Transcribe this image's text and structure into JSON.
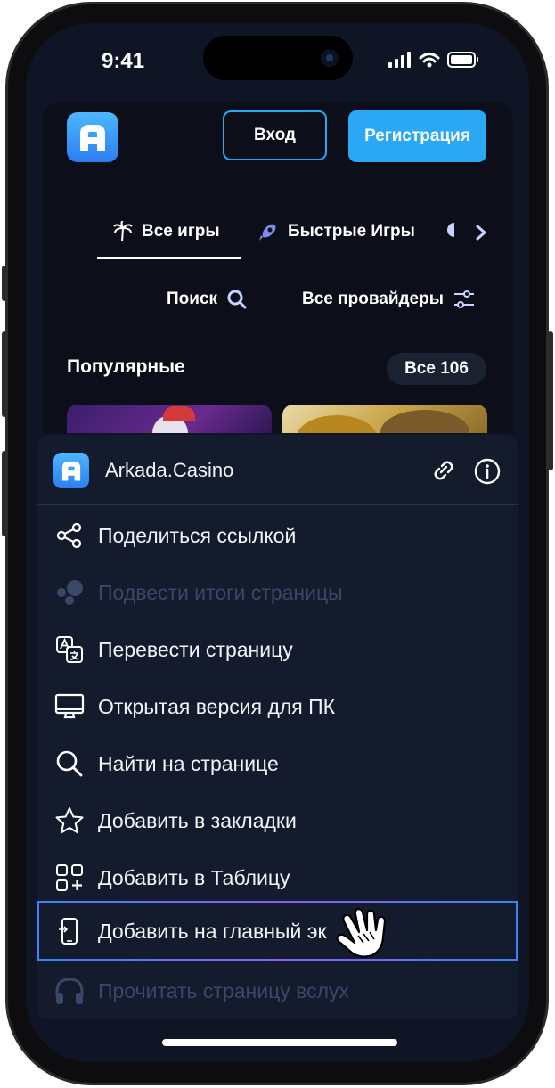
{
  "status_bar": {
    "time": "9:41"
  },
  "site": {
    "login_label": "Вход",
    "register_label": "Регистрация",
    "tabs": [
      {
        "label": "Все игры",
        "icon": "palm-tree-icon",
        "active": true
      },
      {
        "label": "Быстрые Игры",
        "icon": "rocket-icon",
        "active": false
      }
    ],
    "search_label": "Поиск",
    "providers_label": "Все провайдеры",
    "section_title": "Популярные",
    "all_label": "Все 106"
  },
  "sheet": {
    "site_name": "Arkada.Casino",
    "items": [
      {
        "label": "Поделиться ссылкой",
        "icon": "share-icon",
        "disabled": false
      },
      {
        "label": "Подвести итоги страницы",
        "icon": "summary-dots-icon",
        "disabled": true
      },
      {
        "label": "Перевести страницу",
        "icon": "translate-icon",
        "disabled": false
      },
      {
        "label": "Открытая версия для ПК",
        "icon": "desktop-icon",
        "disabled": false
      },
      {
        "label": "Найти на странице",
        "icon": "search-icon",
        "disabled": false
      },
      {
        "label": "Добавить в закладки",
        "icon": "star-icon",
        "disabled": false
      },
      {
        "label": "Добавить в Таблицу",
        "icon": "add-grid-icon",
        "disabled": false
      },
      {
        "label": "Добавить на главный эк",
        "icon": "add-to-home-icon",
        "disabled": false,
        "highlighted": true
      },
      {
        "label": "Прочитать страницу вслух",
        "icon": "headphones-icon",
        "disabled": true
      }
    ]
  },
  "colors": {
    "accent": "#2aa7f5",
    "sheet_bg": "#141b2c",
    "disabled_text": "#3a4766"
  }
}
